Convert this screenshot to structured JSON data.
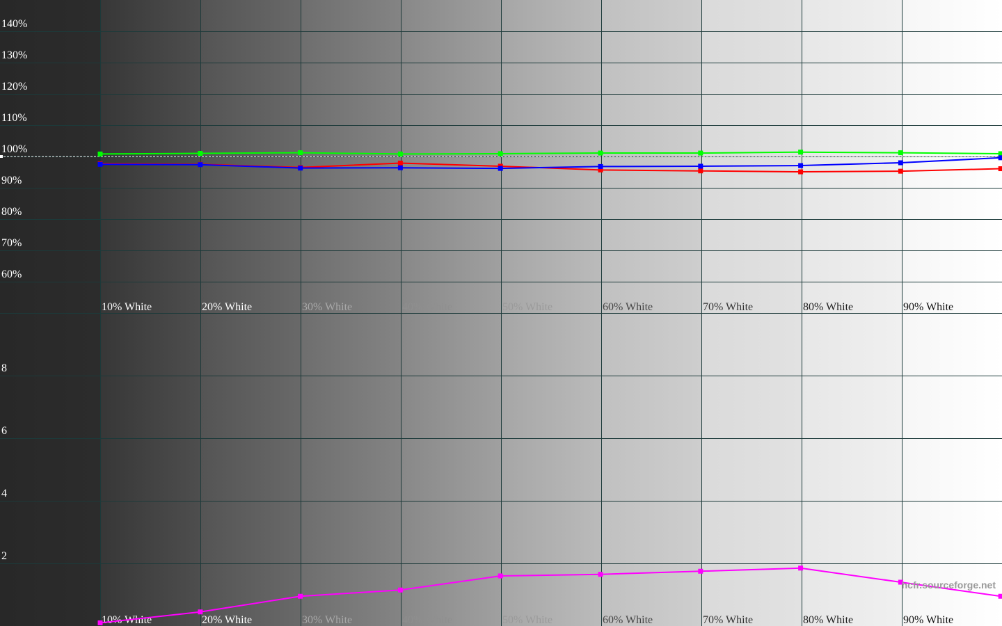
{
  "colors": {
    "red": "#ff0000",
    "green": "#00ff00",
    "blue": "#0000ff",
    "magenta": "#ff00ff",
    "grid": "#1c3a3a",
    "reference": "#ffffff"
  },
  "steps": [
    "10% White",
    "20% White",
    "30% White",
    "40% White",
    "50% White",
    "60% White",
    "70% White",
    "80% White",
    "90% White"
  ],
  "watermark": "hcfr.sourceforge.net",
  "chart_data": [
    {
      "type": "line",
      "title": "",
      "xlabel": "",
      "ylabel": "",
      "x": [
        10,
        20,
        30,
        40,
        50,
        60,
        70,
        80,
        90,
        100
      ],
      "ylim": [
        50,
        150
      ],
      "y_ticks": [
        "140%",
        "130%",
        "120%",
        "110%",
        "100%",
        "90%",
        "80%",
        "70%",
        "60%"
      ],
      "y_tick_values": [
        140,
        130,
        120,
        110,
        100,
        90,
        80,
        70,
        60
      ],
      "reference_line": 100,
      "grid": true,
      "series": [
        {
          "color": "green",
          "values": [
            100.8,
            101.0,
            101.2,
            100.8,
            100.9,
            101.1,
            101.1,
            101.4,
            101.2,
            100.9
          ]
        },
        {
          "color": "red",
          "values": [
            97.7,
            97.5,
            96.5,
            97.9,
            96.9,
            95.7,
            95.4,
            95.1,
            95.3,
            96.1
          ]
        },
        {
          "color": "blue",
          "values": [
            97.5,
            97.4,
            96.3,
            96.4,
            96.2,
            96.8,
            96.9,
            97.1,
            98.0,
            99.6
          ]
        }
      ]
    },
    {
      "type": "line",
      "title": "",
      "xlabel": "",
      "ylabel": "",
      "x": [
        10,
        20,
        30,
        40,
        50,
        60,
        70,
        80,
        90,
        100
      ],
      "ylim": [
        0,
        10
      ],
      "y_ticks": [
        "8",
        "6",
        "4",
        "2"
      ],
      "y_tick_values": [
        8,
        6,
        4,
        2
      ],
      "grid": true,
      "series": [
        {
          "color": "magenta",
          "values": [
            0.1,
            0.45,
            0.95,
            1.15,
            1.6,
            1.65,
            1.75,
            1.85,
            1.4,
            0.95
          ]
        }
      ]
    }
  ]
}
